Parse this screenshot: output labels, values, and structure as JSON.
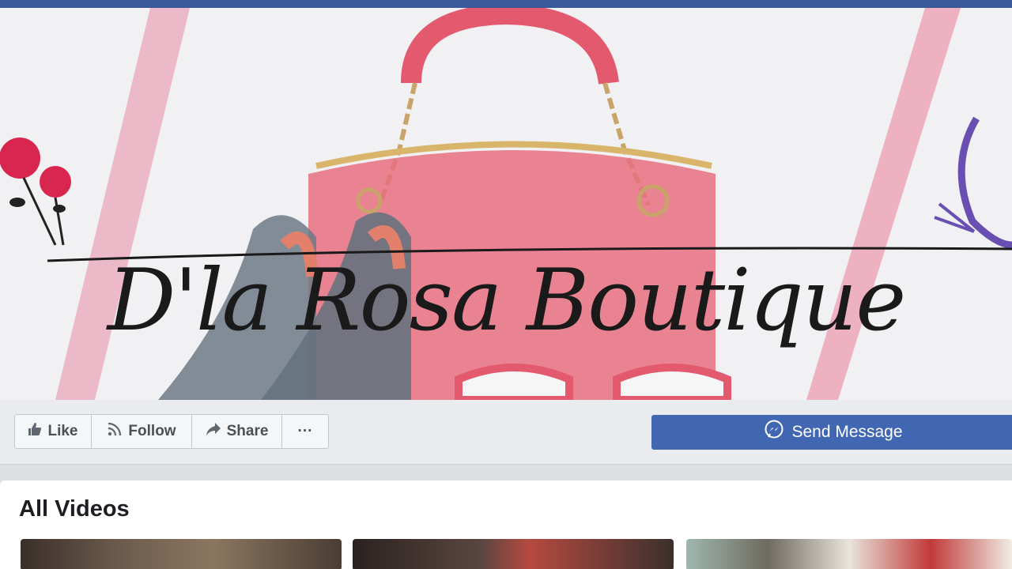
{
  "page": {
    "brand_name": "D'la Rosa Boutique"
  },
  "actions": {
    "like_label": "Like",
    "follow_label": "Follow",
    "share_label": "Share",
    "more_label": "···",
    "send_message_label": "Send Message"
  },
  "videos": {
    "section_title": "All Videos"
  },
  "colors": {
    "facebook_blue": "#3b5998",
    "button_blue": "#4267b2",
    "rose_red": "#d9264f",
    "bag_pink": "#e8707f"
  },
  "icons": [
    "thumbs-up-icon",
    "rss-follow-icon",
    "share-arrow-icon",
    "more-dots-icon",
    "messenger-icon"
  ]
}
